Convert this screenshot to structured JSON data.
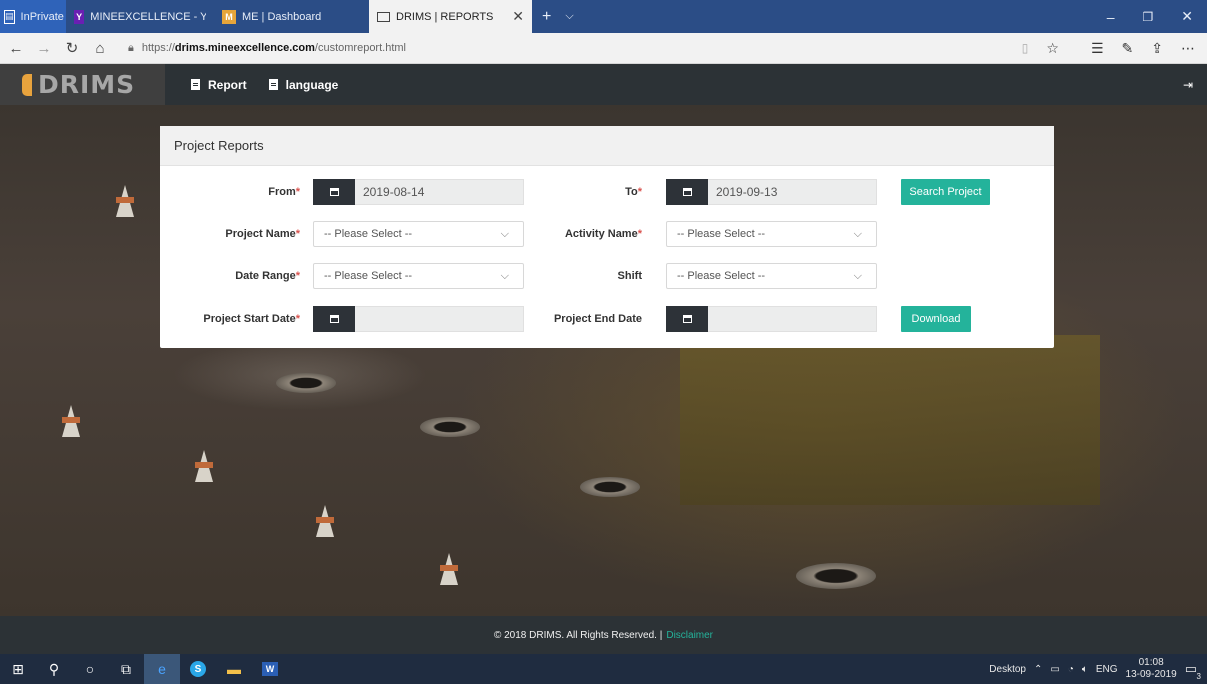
{
  "browser": {
    "tabs": [
      {
        "label": "InPrivate"
      },
      {
        "label": "MINEEXCELLENCE - Yahoo Se"
      },
      {
        "label": "ME | Dashboard"
      },
      {
        "label": "DRIMS | REPORTS"
      }
    ],
    "url_prefix": "https://",
    "url_domain": "drims.mineexcellence.com",
    "url_path": "/customreport.html"
  },
  "app": {
    "logo": "DRIMS",
    "menu": [
      {
        "label": "Report"
      },
      {
        "label": "language"
      }
    ]
  },
  "card": {
    "title": "Project Reports",
    "from_label": "From",
    "from_value": "2019-08-14",
    "to_label": "To",
    "to_value": "2019-09-13",
    "search_button": "Search Project",
    "project_name_label": "Project Name",
    "project_name_value": "-- Please Select --",
    "activity_name_label": "Activity Name",
    "activity_name_value": "-- Please Select --",
    "date_range_label": "Date Range",
    "date_range_value": "-- Please Select --",
    "shift_label": "Shift",
    "shift_value": "-- Please Select --",
    "start_date_label": "Project Start Date",
    "end_date_label": "Project End Date",
    "download_button": "Download",
    "required_mark": "*"
  },
  "footer": {
    "copyright": "© 2018 DRIMS. All Rights Reserved. |",
    "disclaimer": "Disclaimer"
  },
  "taskbar": {
    "desktop_label": "Desktop",
    "language": "ENG",
    "time": "01:08",
    "date": "13-09-2019",
    "notification_count": "3"
  },
  "colors": {
    "accent_green": "#24b39b",
    "header_dark": "#2c3236",
    "required_red": "#d9534f"
  }
}
